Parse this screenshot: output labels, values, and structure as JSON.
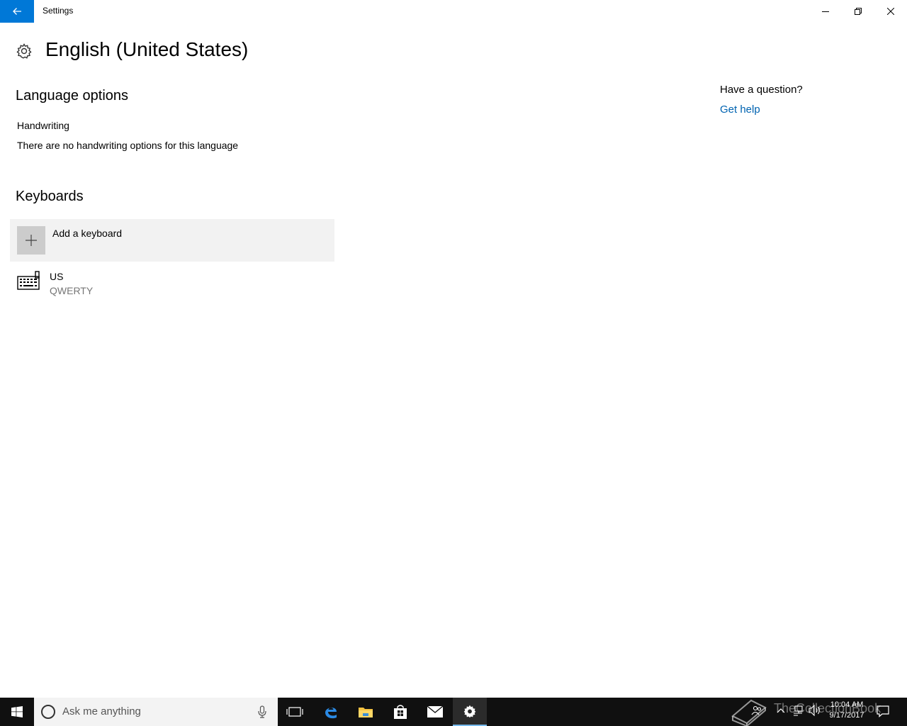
{
  "window": {
    "title": "Settings"
  },
  "page": {
    "title": "English (United States)"
  },
  "language_options": {
    "heading": "Language options",
    "handwriting_label": "Handwriting",
    "handwriting_desc": "There are no handwriting options for this language"
  },
  "keyboards": {
    "heading": "Keyboards",
    "add_label": "Add a keyboard",
    "items": [
      {
        "name": "US",
        "layout": "QWERTY"
      }
    ]
  },
  "help": {
    "question": "Have a question?",
    "link": "Get help"
  },
  "taskbar": {
    "search_placeholder": "Ask me anything",
    "clock_time": "10:04 AM",
    "clock_date": "9/17/2017",
    "watermark": "TheCollectionBook"
  },
  "colors": {
    "accent": "#0078d7",
    "link": "#0063b1",
    "taskbar": "#101010"
  }
}
